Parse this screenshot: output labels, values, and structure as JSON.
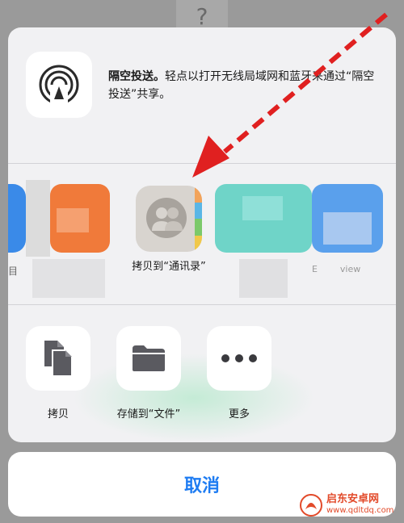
{
  "background": {
    "help_glyph": "?"
  },
  "airdrop": {
    "icon": "airdrop-icon",
    "title": "隔空投送。",
    "description": "轻点以打开无线局域网和蓝牙来通过“隔空投送”共享。"
  },
  "apps": {
    "contacts_label": "拷贝到“通讯录”",
    "blurred_label_left": "目",
    "blurred_label_right": "E        view"
  },
  "actions": [
    {
      "label": "拷贝",
      "icon": "copy-icon"
    },
    {
      "label": "存储到“文件”",
      "icon": "folder-icon"
    },
    {
      "label": "更多",
      "icon": "more-icon"
    }
  ],
  "cancel_label": "取消",
  "watermark": {
    "main": "启东安卓网",
    "sub": "www.qdltdq.com"
  },
  "colors": {
    "accent": "#1e7cf2",
    "arrow": "#e02020"
  }
}
